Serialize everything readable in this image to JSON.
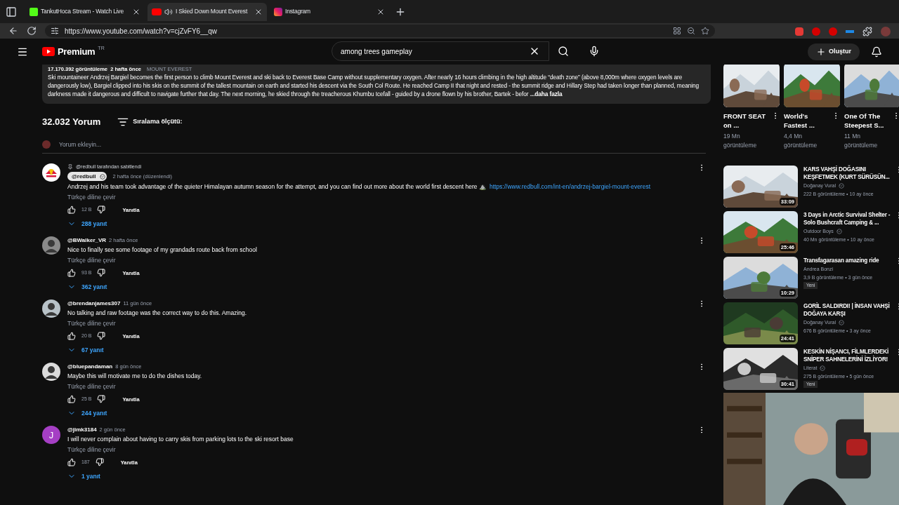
{
  "browser": {
    "tabs": [
      {
        "title": "TankutHoca Stream - Watch Live",
        "kind": "kick",
        "selected": false,
        "playing": false
      },
      {
        "title": "I Skied Down Mount Everest",
        "kind": "youtube",
        "selected": true,
        "playing": true
      },
      {
        "title": "Instagram",
        "kind": "instagram",
        "selected": false,
        "playing": false
      }
    ],
    "url": "https://www.youtube.com/watch?v=cjZvFY6__qw"
  },
  "header": {
    "logo": "Premium",
    "region": "TR",
    "search": "among trees gameplay",
    "create": "Oluştur"
  },
  "description": {
    "meta": "17.170.392 görüntüleme  2 hafta önce",
    "tag": "MOUNT EVEREST",
    "text": "Ski mountaineer Andrzej Bargiel becomes the first person to climb Mount Everest and ski back to Everest Base Camp without supplementary oxygen. After nearly 16 hours climbing in the high altitude “death zone” (above 8,000m where oxygen levels are dangerously low), Bargiel clipped into his skis on the summit of the tallest mountain on earth and started his descent via the South Col Route. He reached Camp II that night and rested - the summit ridge and Hillary Step had taken longer than planned, meaning darkness made it dangerous and difficult to navigate further that day. The next morning, he skied through the treacherous Khumbu Icefall - guided by a drone flown by his brother, Bartek - befor",
    "more": "...daha fazla"
  },
  "comments": {
    "count": "32.032 Yorum",
    "sort": "Sıralama ölçütü:",
    "add_placeholder": "Yorum ekleyin...",
    "items": [
      {
        "kind": "logo",
        "pinned": "@redbull tarafından sabitlendi",
        "author": "@redbull",
        "creator": true,
        "time": "2 hafta önce (düzenlendi)",
        "text": "Andrzej and his team took advantage of the quieter Himalayan autumn season for the attempt, and you can find out more about the world first descent here ⛰️",
        "link": "https://www.redbull.com/int-en/andrzej-bargiel-mount-everest",
        "translate": "Türkçe diline çevir",
        "likes": "12 B",
        "reply": "Yanıtla",
        "replies": "288 yanıt"
      },
      {
        "author": "@BWalker_VR",
        "creator": false,
        "time": "2 hafta önce",
        "text": "Nice to finally see some footage of my grandads route back from school",
        "translate": "Türkçe diline çevir",
        "likes": "93 B",
        "reply": "Yanıtla",
        "replies": "362 yanıt"
      },
      {
        "author": "@brendanjames307",
        "creator": false,
        "time": "11 gün önce",
        "text": "No talking and raw footage was the correct way to do this. Amazing.",
        "translate": "Türkçe diline çevir",
        "likes": "20 B",
        "reply": "Yanıtla",
        "replies": "67 yanıt"
      },
      {
        "author": "@bluepandaman",
        "creator": false,
        "time": "8 gün önce",
        "text": "Maybe this will motivate me to do the dishes today.",
        "translate": "Türkçe diline çevir",
        "likes": "25 B",
        "reply": "Yanıtla",
        "replies": "244 yanıt"
      },
      {
        "kind": "letter",
        "letter": "J",
        "color": "#a53fc4",
        "author": "@jimk3184",
        "creator": false,
        "time": "2 gün önce",
        "text": "I will never complain about having to carry skis from parking lots to the ski resort base",
        "translate": "Türkçe diline çevir",
        "likes": "187",
        "reply": "Yanıtla",
        "replies": "1 yanıt"
      }
    ]
  },
  "shorts": [
    {
      "title": "FRONT SEAT on ...",
      "views": "19 Mn görüntüleme"
    },
    {
      "title": "World's Fastest ...",
      "views": "4,4 Mn görüntüleme"
    },
    {
      "title": "One Of The Steepest S...",
      "views": "11 Mn görüntüleme"
    }
  ],
  "videos": [
    {
      "title": "KARS VAHŞİ DOĞASINI KEŞFETMEK (KURT SÜRÜSÜN...",
      "channel": "Doğanay Vural",
      "verified": true,
      "meta": "222 B görüntüleme • 10 ay önce",
      "duration": "33:09"
    },
    {
      "title": "3 Days in Arctic Survival Shelter - Solo Bushcraft Camping & ...",
      "channel": "Outdoor Boys",
      "verified": true,
      "meta": "40 Mn görüntüleme • 10 ay önce",
      "duration": "25:46"
    },
    {
      "title": "Transfagarasan amazing ride",
      "channel": "Andrea Bonzi",
      "verified": false,
      "meta": "3,9 B görüntüleme • 3 gün önce",
      "duration": "10:29",
      "badge": "Yeni"
    },
    {
      "title": "GORİL SALDIRDI! | İNSAN VAHŞİ DOĞAYA KARŞI",
      "channel": "Doğanay Vural",
      "verified": true,
      "meta": "676 B görüntüleme • 3 ay önce",
      "duration": "24:41"
    },
    {
      "title": "KESKİN NİŞANCI, FİLMLERDEKİ SNİPER SAHNELERİNİ İZLİYOR!",
      "channel": "Literat",
      "verified": true,
      "meta": "275 B görüntüleme • 5 gün önce",
      "duration": "30:41",
      "badge": "Yeni"
    }
  ]
}
